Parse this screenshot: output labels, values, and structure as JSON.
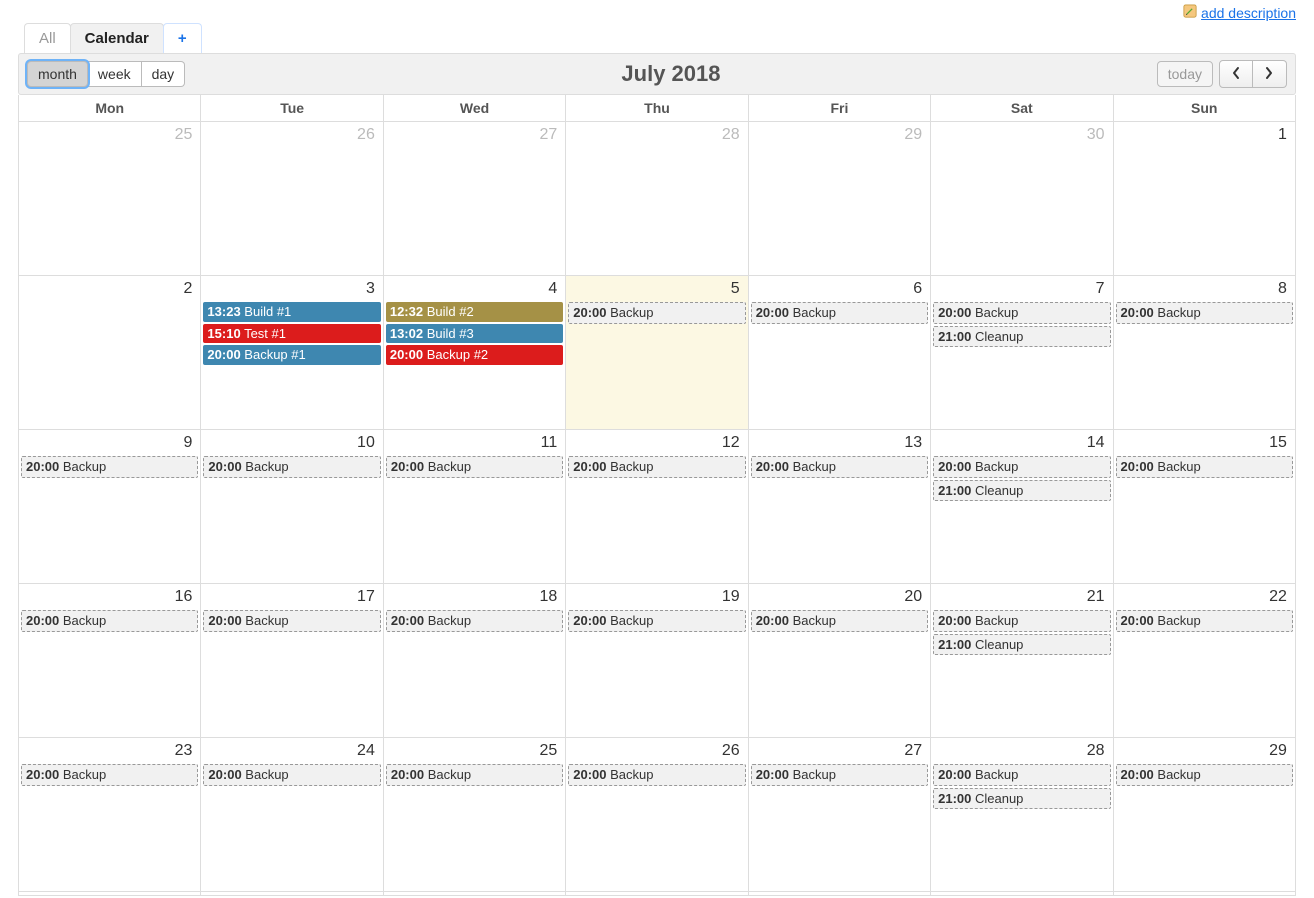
{
  "addDescription": "add description",
  "tabs": {
    "all": "All",
    "calendar": "Calendar",
    "plus": "+"
  },
  "views": {
    "month": "month",
    "week": "week",
    "day": "day"
  },
  "title": "July 2018",
  "today": "today",
  "daynames": [
    "Mon",
    "Tue",
    "Wed",
    "Thu",
    "Fri",
    "Sat",
    "Sun"
  ],
  "calendar": {
    "weeks": [
      [
        {
          "num": "25",
          "other": true,
          "events": []
        },
        {
          "num": "26",
          "other": true,
          "events": []
        },
        {
          "num": "27",
          "other": true,
          "events": []
        },
        {
          "num": "28",
          "other": true,
          "events": []
        },
        {
          "num": "29",
          "other": true,
          "events": []
        },
        {
          "num": "30",
          "other": true,
          "events": []
        },
        {
          "num": "1",
          "events": []
        }
      ],
      [
        {
          "num": "2",
          "events": []
        },
        {
          "num": "3",
          "events": [
            {
              "time": "13:23",
              "label": "Build #1",
              "style": "blue"
            },
            {
              "time": "15:10",
              "label": "Test #1",
              "style": "red"
            },
            {
              "time": "20:00",
              "label": "Backup #1",
              "style": "blue"
            }
          ]
        },
        {
          "num": "4",
          "events": [
            {
              "time": "12:32",
              "label": "Build #2",
              "style": "olive"
            },
            {
              "time": "13:02",
              "label": "Build #3",
              "style": "blue"
            },
            {
              "time": "20:00",
              "label": "Backup #2",
              "style": "red"
            }
          ]
        },
        {
          "num": "5",
          "today": true,
          "events": [
            {
              "time": "20:00",
              "label": "Backup",
              "style": "dashed"
            }
          ]
        },
        {
          "num": "6",
          "events": [
            {
              "time": "20:00",
              "label": "Backup",
              "style": "dashed"
            }
          ]
        },
        {
          "num": "7",
          "events": [
            {
              "time": "20:00",
              "label": "Backup",
              "style": "dashed"
            },
            {
              "time": "21:00",
              "label": "Cleanup",
              "style": "dashed"
            }
          ]
        },
        {
          "num": "8",
          "events": [
            {
              "time": "20:00",
              "label": "Backup",
              "style": "dashed"
            }
          ]
        }
      ],
      [
        {
          "num": "9",
          "events": [
            {
              "time": "20:00",
              "label": "Backup",
              "style": "dashed"
            }
          ]
        },
        {
          "num": "10",
          "events": [
            {
              "time": "20:00",
              "label": "Backup",
              "style": "dashed"
            }
          ]
        },
        {
          "num": "11",
          "events": [
            {
              "time": "20:00",
              "label": "Backup",
              "style": "dashed"
            }
          ]
        },
        {
          "num": "12",
          "events": [
            {
              "time": "20:00",
              "label": "Backup",
              "style": "dashed"
            }
          ]
        },
        {
          "num": "13",
          "events": [
            {
              "time": "20:00",
              "label": "Backup",
              "style": "dashed"
            }
          ]
        },
        {
          "num": "14",
          "events": [
            {
              "time": "20:00",
              "label": "Backup",
              "style": "dashed"
            },
            {
              "time": "21:00",
              "label": "Cleanup",
              "style": "dashed"
            }
          ]
        },
        {
          "num": "15",
          "events": [
            {
              "time": "20:00",
              "label": "Backup",
              "style": "dashed"
            }
          ]
        }
      ],
      [
        {
          "num": "16",
          "events": [
            {
              "time": "20:00",
              "label": "Backup",
              "style": "dashed"
            }
          ]
        },
        {
          "num": "17",
          "events": [
            {
              "time": "20:00",
              "label": "Backup",
              "style": "dashed"
            }
          ]
        },
        {
          "num": "18",
          "events": [
            {
              "time": "20:00",
              "label": "Backup",
              "style": "dashed"
            }
          ]
        },
        {
          "num": "19",
          "events": [
            {
              "time": "20:00",
              "label": "Backup",
              "style": "dashed"
            }
          ]
        },
        {
          "num": "20",
          "events": [
            {
              "time": "20:00",
              "label": "Backup",
              "style": "dashed"
            }
          ]
        },
        {
          "num": "21",
          "events": [
            {
              "time": "20:00",
              "label": "Backup",
              "style": "dashed"
            },
            {
              "time": "21:00",
              "label": "Cleanup",
              "style": "dashed"
            }
          ]
        },
        {
          "num": "22",
          "events": [
            {
              "time": "20:00",
              "label": "Backup",
              "style": "dashed"
            }
          ]
        }
      ],
      [
        {
          "num": "23",
          "events": [
            {
              "time": "20:00",
              "label": "Backup",
              "style": "dashed"
            }
          ]
        },
        {
          "num": "24",
          "events": [
            {
              "time": "20:00",
              "label": "Backup",
              "style": "dashed"
            }
          ]
        },
        {
          "num": "25",
          "events": [
            {
              "time": "20:00",
              "label": "Backup",
              "style": "dashed"
            }
          ]
        },
        {
          "num": "26",
          "events": [
            {
              "time": "20:00",
              "label": "Backup",
              "style": "dashed"
            }
          ]
        },
        {
          "num": "27",
          "events": [
            {
              "time": "20:00",
              "label": "Backup",
              "style": "dashed"
            }
          ]
        },
        {
          "num": "28",
          "events": [
            {
              "time": "20:00",
              "label": "Backup",
              "style": "dashed"
            },
            {
              "time": "21:00",
              "label": "Cleanup",
              "style": "dashed"
            }
          ]
        },
        {
          "num": "29",
          "events": [
            {
              "time": "20:00",
              "label": "Backup",
              "style": "dashed"
            }
          ]
        }
      ]
    ]
  }
}
